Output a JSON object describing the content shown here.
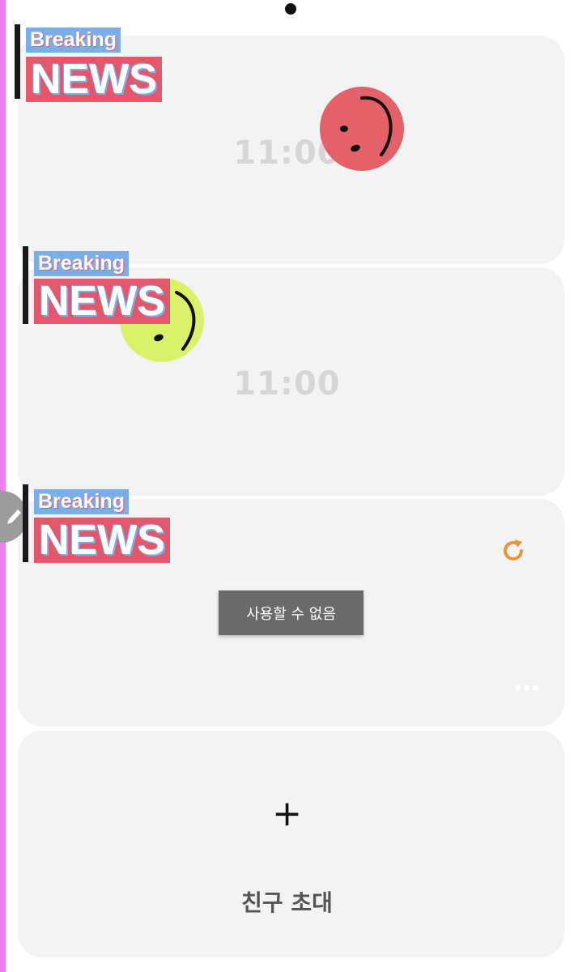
{
  "cards": [
    {
      "time": "11:00",
      "sticker": {
        "top": "Breaking",
        "bottom": "NEWS"
      },
      "emoji": "smiley-red"
    },
    {
      "time": "11:00",
      "sticker": {
        "top": "Breaking",
        "bottom": "NEWS"
      },
      "emoji": "smiley-lime"
    },
    {
      "sticker": {
        "top": "Breaking",
        "bottom": "NEWS"
      },
      "toast": "사용할 수 없음",
      "refresh_icon": "refresh-icon",
      "more_icon": "more-horizontal-icon"
    },
    {
      "add_icon": "+",
      "label": "친구 초대"
    }
  ],
  "colors": {
    "accent_strip": "#e97ff0",
    "card_bg": "#f3f3f3",
    "refresh": "#e9953a",
    "smiley_red": "#e4616a",
    "smiley_lime": "#d9f26a",
    "news_red": "#e4566a",
    "news_blue": "#7aaee8"
  },
  "icons": {
    "pencil": "pencil-icon",
    "top_indicator": "dot-icon"
  }
}
